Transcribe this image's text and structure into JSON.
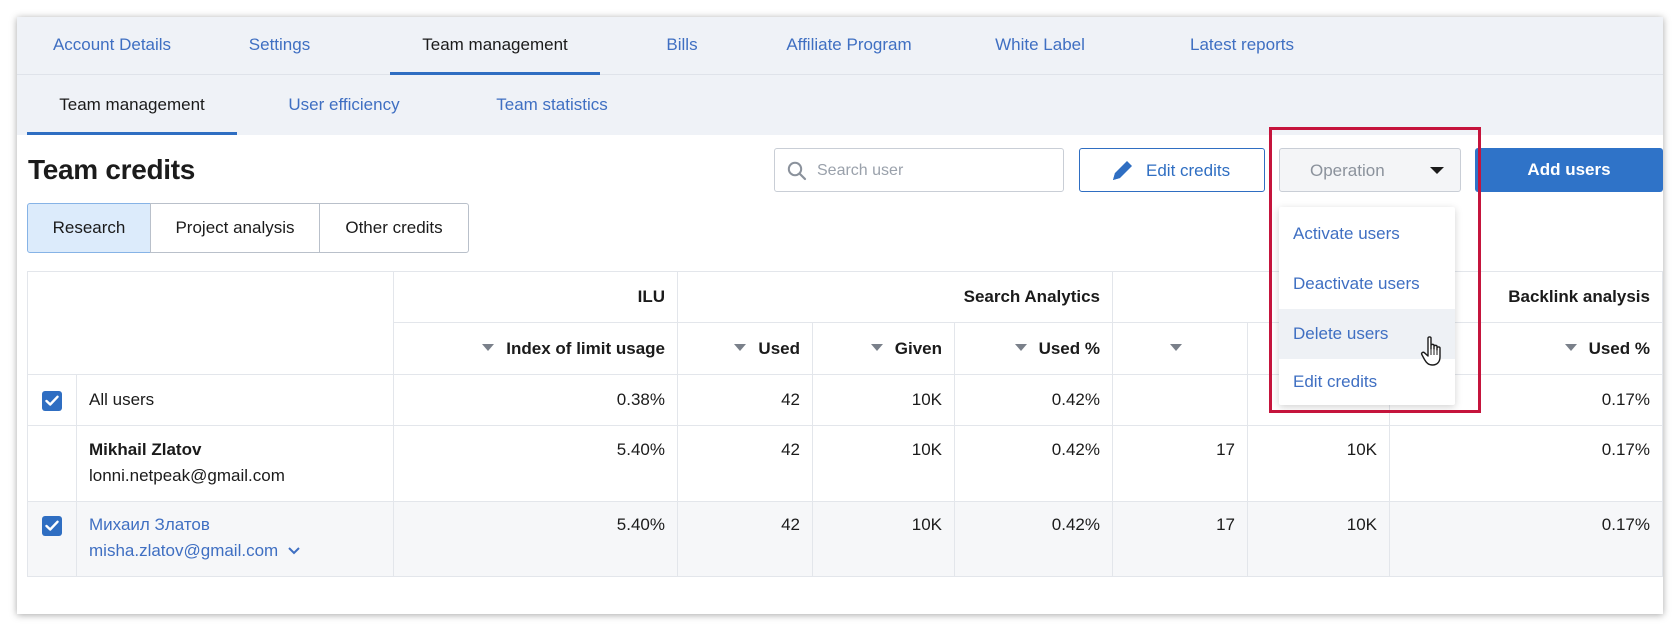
{
  "topnav": {
    "tabs": [
      {
        "label": "Account Details"
      },
      {
        "label": "Settings"
      },
      {
        "label": "Team management"
      },
      {
        "label": "Bills"
      },
      {
        "label": "Affiliate Program"
      },
      {
        "label": "White Label"
      },
      {
        "label": "Latest reports"
      }
    ],
    "active_index": 2
  },
  "subnav": {
    "tabs": [
      {
        "label": "Team management"
      },
      {
        "label": "User efficiency"
      },
      {
        "label": "Team statistics"
      }
    ],
    "active_index": 0
  },
  "page": {
    "title": "Team credits"
  },
  "toolbar": {
    "search_placeholder": "Search user",
    "edit_credits_label": "Edit credits",
    "operation_label": "Operation",
    "add_users_label": "Add users"
  },
  "segments": {
    "items": [
      {
        "label": "Research"
      },
      {
        "label": "Project analysis"
      },
      {
        "label": "Other credits"
      }
    ],
    "active_index": 0
  },
  "table": {
    "groups": {
      "ilu": "ILU",
      "search_analytics": "Search Analytics",
      "backlink_analysis": "Backlink analysis"
    },
    "columns": {
      "index_of_limit_usage": "Index of limit usage",
      "used": "Used",
      "given": "Given",
      "used_pct": "Used %",
      "ba_used_pct": "Used %"
    },
    "rows": [
      {
        "checked": true,
        "name": "All users",
        "email": "",
        "ilu": "0.38%",
        "sa_used": "42",
        "sa_given": "10K",
        "sa_used_pct": "0.42%",
        "b_used": "",
        "b_given": "",
        "ba_used_pct": "0.17%"
      },
      {
        "checked": false,
        "name": "Mikhail Zlatov",
        "email": "lonni.netpeak@gmail.com",
        "ilu": "5.40%",
        "sa_used": "42",
        "sa_given": "10K",
        "sa_used_pct": "0.42%",
        "b_used": "17",
        "b_given": "10K",
        "ba_used_pct": "0.17%"
      },
      {
        "checked": true,
        "name": "Михаил Златов",
        "email": "misha.zlatov@gmail.com",
        "ilu": "5.40%",
        "sa_used": "42",
        "sa_given": "10K",
        "sa_used_pct": "0.42%",
        "b_used": "17",
        "b_given": "10K",
        "ba_used_pct": "0.17%"
      }
    ]
  },
  "operation_menu": {
    "items": [
      {
        "label": "Activate users"
      },
      {
        "label": "Deactivate users"
      },
      {
        "label": "Delete users"
      },
      {
        "label": "Edit credits"
      }
    ],
    "hover_index": 2
  },
  "colors": {
    "accent": "#2f6ec2",
    "link": "#3f6fc2",
    "highlight": "#c5143c",
    "nav_bg": "#eff2f7"
  },
  "icons": {
    "search": "search-icon",
    "pencil": "pencil-icon",
    "caret": "caret-down-icon",
    "check": "check-icon",
    "cursor": "hand-pointer-icon",
    "chevron": "chevron-down-icon"
  }
}
